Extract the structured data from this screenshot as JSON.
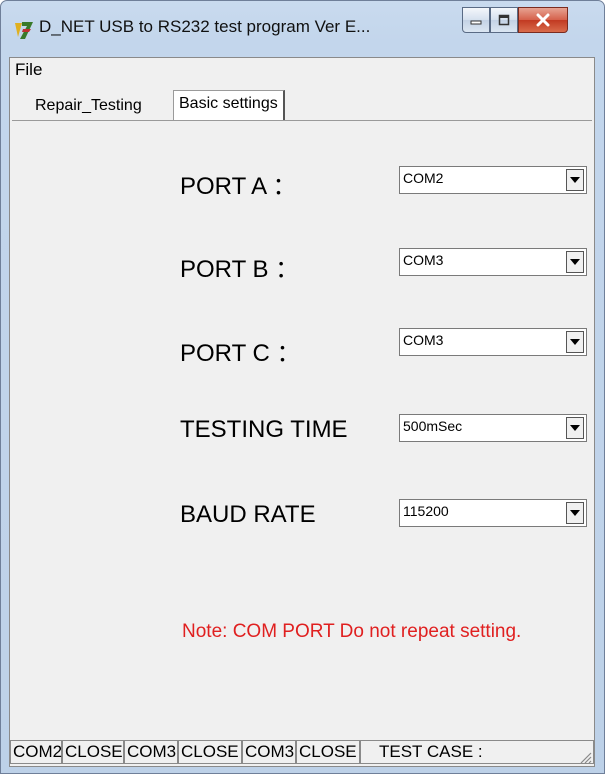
{
  "window": {
    "title": "D_NET USB to RS232 test program Ver E...",
    "icon": "app-logo-icon"
  },
  "menu": {
    "file": "File"
  },
  "tabs": [
    {
      "label": "Repair_Testing",
      "active": false
    },
    {
      "label": "Basic settings",
      "active": true
    }
  ],
  "settings": {
    "port_a": {
      "label": "PORT A ：",
      "value": "COM2"
    },
    "port_b": {
      "label": "PORT B ：",
      "value": "COM3"
    },
    "port_c": {
      "label": "PORT C ：",
      "value": "COM3"
    },
    "testing_time": {
      "label": "TESTING TIME",
      "value": "500mSec"
    },
    "baud_rate": {
      "label": "BAUD RATE",
      "value": "115200"
    }
  },
  "note": "Note: COM PORT Do not repeat setting.",
  "statusbar": [
    "COM2",
    "CLOSE",
    "COM3",
    "CLOSE",
    "COM3",
    "CLOSE",
    "TEST CASE :"
  ],
  "colors": {
    "note": "#e02020",
    "window_frame": "#c3d6ec",
    "close_button": "#c23a22"
  }
}
